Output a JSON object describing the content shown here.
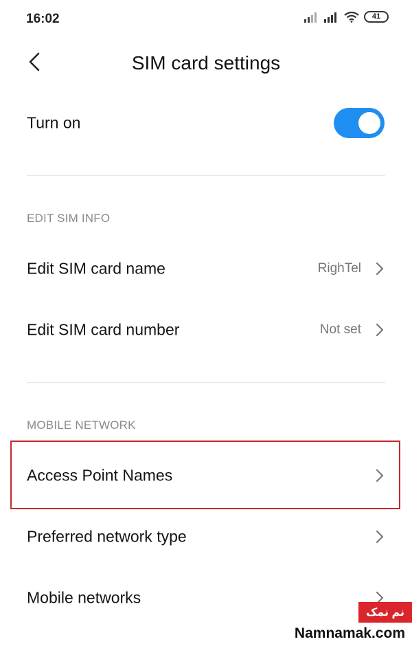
{
  "status_bar": {
    "time": "16:02",
    "battery_level": "41",
    "icons": [
      "signal-icon",
      "signal-icon",
      "wifi-icon",
      "battery-icon"
    ]
  },
  "header": {
    "back_icon": "chevron-left-icon",
    "title": "SIM card settings"
  },
  "turn_on": {
    "label": "Turn on",
    "enabled": true,
    "accent_color": "#1f8ef1"
  },
  "edit_sim_info": {
    "section_title": "EDIT SIM INFO",
    "items": [
      {
        "label": "Edit SIM card name",
        "value": "RighTel"
      },
      {
        "label": "Edit SIM card number",
        "value": "Not set"
      }
    ]
  },
  "mobile_network": {
    "section_title": "MOBILE NETWORK",
    "items": [
      {
        "label": "Access Point Names",
        "highlighted": true
      },
      {
        "label": "Preferred network type"
      },
      {
        "label": "Mobile networks"
      }
    ]
  },
  "highlight_color": "#c9262e",
  "watermark": {
    "badge": "نم نمک",
    "text": "Namnamak.com"
  }
}
